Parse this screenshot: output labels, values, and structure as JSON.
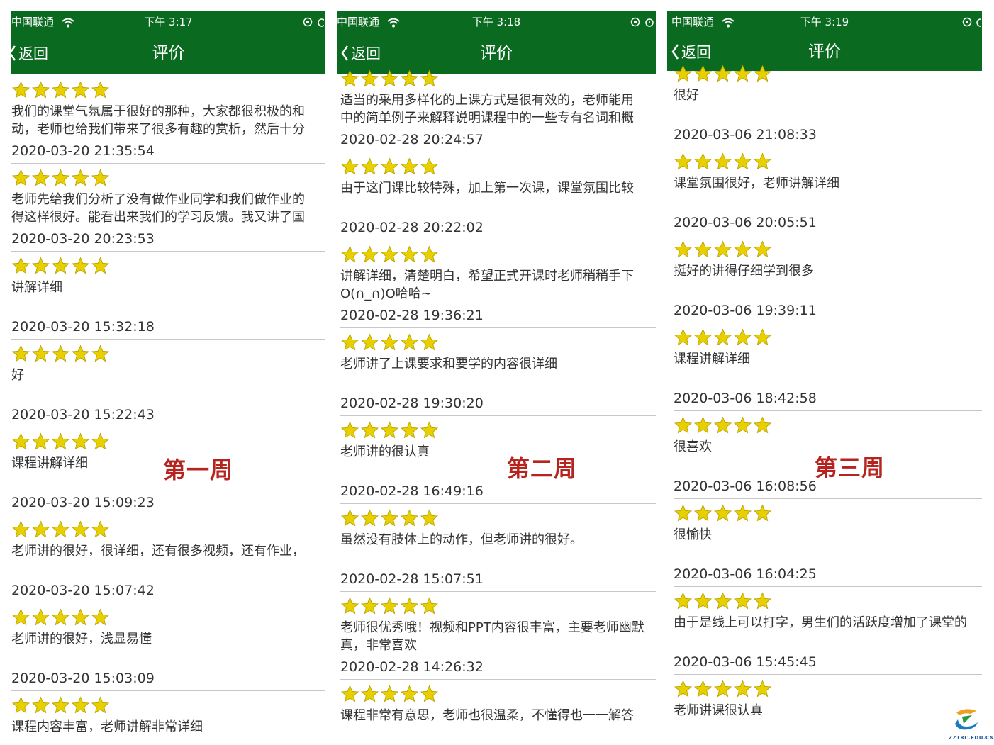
{
  "colors": {
    "nav": "#0a6a1f",
    "star": "#e8d000",
    "week_label": "#b5241e"
  },
  "phones": [
    {
      "carrier": "中国联通",
      "time": "下午 3:17",
      "back": "返回",
      "title": "评价",
      "week": "第一周",
      "reviews": [
        {
          "rating": 5,
          "text": "我们的课堂气氛属于很好的那种，大家都很积极的和\n动，老师也给我们带来了很多有趣的赏析，然后十分",
          "date": "2020-03-20 21:35:54"
        },
        {
          "rating": 5,
          "text": "老师先给我们分析了没有做作业同学和我们做作业的\n得这样很好。能看出来我们的学习反馈。我又讲了国",
          "date": "2020-03-20 20:23:53"
        },
        {
          "rating": 5,
          "text": "讲解详细",
          "date": "2020-03-20 15:32:18"
        },
        {
          "rating": 5,
          "text": "好",
          "date": "2020-03-20 15:22:43"
        },
        {
          "rating": 5,
          "text": "课程讲解详细",
          "date": "2020-03-20 15:09:23"
        },
        {
          "rating": 5,
          "text": "老师讲的很好，很详细，还有很多视频，还有作业，",
          "date": "2020-03-20 15:07:42"
        },
        {
          "rating": 5,
          "text": "老师讲的很好，浅显易懂",
          "date": "2020-03-20 15:03:09"
        },
        {
          "rating": 5,
          "text": "课程内容丰富，老师讲解非常详细",
          "date": ""
        }
      ]
    },
    {
      "carrier": "中国联通",
      "time": "下午 3:18",
      "back": "返回",
      "title": "评价",
      "week": "第二周",
      "reviews": [
        {
          "rating": 5,
          "text": "适当的采用多样化的上课方式是很有效的，老师能用\n中的简单例子来解释说明课程中的一些专有名词和概",
          "date": "2020-02-28 20:24:57"
        },
        {
          "rating": 5,
          "text": "由于这门课比较特殊，加上第一次课，课堂氛围比较",
          "date": "2020-02-28 20:22:02"
        },
        {
          "rating": 5,
          "text": "讲解详细，清楚明白，希望正式开课时老师稍稍手下\nO(∩_∩)O哈哈~",
          "date": "2020-02-28 19:36:21"
        },
        {
          "rating": 5,
          "text": "老师讲了上课要求和要学的内容很详细",
          "date": "2020-02-28 19:30:20"
        },
        {
          "rating": 5,
          "text": "老师讲的很认真",
          "date": "2020-02-28 16:49:16"
        },
        {
          "rating": 5,
          "text": "虽然没有肢体上的动作，但老师讲的很好。",
          "date": "2020-02-28 15:07:51"
        },
        {
          "rating": 5,
          "text": "老师很优秀哦！视频和PPT内容很丰富，主要老师幽默\n真，非常喜欢",
          "date": "2020-02-28 14:26:32"
        },
        {
          "rating": 5,
          "text": "课程非常有意思，老师也很温柔，不懂得也一一解答",
          "date": ""
        }
      ]
    },
    {
      "carrier": "中国联通",
      "time": "下午 3:19",
      "back": "返回",
      "title": "评价",
      "week": "第三周",
      "reviews": [
        {
          "rating": 5,
          "text": "很好",
          "date": "2020-03-06 21:08:33"
        },
        {
          "rating": 5,
          "text": "课堂氛围很好，老师讲解详细",
          "date": "2020-03-06 20:05:51"
        },
        {
          "rating": 5,
          "text": "挺好的讲得仔细学到很多",
          "date": "2020-03-06 19:39:11"
        },
        {
          "rating": 5,
          "text": "课程讲解详细",
          "date": "2020-03-06 18:42:58"
        },
        {
          "rating": 5,
          "text": "很喜欢",
          "date": "2020-03-06 16:08:56"
        },
        {
          "rating": 5,
          "text": "很愉快",
          "date": "2020-03-06 16:04:25"
        },
        {
          "rating": 5,
          "text": "由于是线上可以打字，男生们的活跃度增加了课堂的",
          "date": "2020-03-06 15:45:45"
        },
        {
          "rating": 5,
          "text": "老师讲课很认真",
          "date": ""
        }
      ]
    }
  ],
  "logo": {
    "text": "ZZTRC.EDU.CN"
  }
}
